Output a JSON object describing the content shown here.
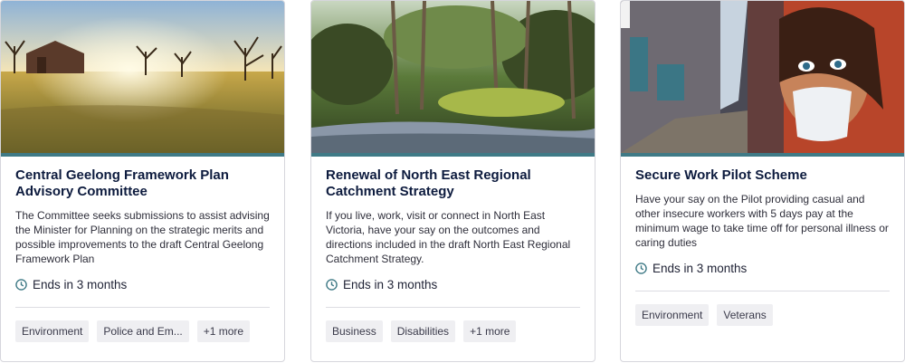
{
  "cards": [
    {
      "title": "Central Geelong Framework Plan Advisory Committee",
      "description": "The Committee seeks submissions to assist advising the Minister for Planning on the strategic merits and possible improvements to the draft Central Geelong Framework Plan",
      "status": "Ends in 3 months",
      "tags": [
        "Environment",
        "Police and Em...",
        "+1 more"
      ],
      "image": "sunrise-field-with-barn-photo"
    },
    {
      "title": "Renewal of North East Regional Catchment Strategy",
      "description": "If you live, work, visit or connect in North East Victoria, have your say on the outcomes and directions included in the draft North East Regional Catchment Strategy.",
      "status": "Ends in 3 months",
      "tags": [
        "Business",
        "Disabilities",
        "+1 more"
      ],
      "image": "creek-in-forest-photo"
    },
    {
      "title": "Secure Work Pilot Scheme",
      "description": "Have your say on the Pilot providing casual and other insecure workers with 5 days pay at the minimum wage to take time off for personal illness or caring duties",
      "status": "Ends in 3 months",
      "tags": [
        "Environment",
        "Veterans"
      ],
      "image": "laneway-street-art-mural-photo"
    }
  ],
  "colors": {
    "accent": "#3f7a86",
    "title": "#0d1b3e",
    "tag_bg": "#efeff2"
  },
  "icons": {
    "status": "clock-icon"
  }
}
